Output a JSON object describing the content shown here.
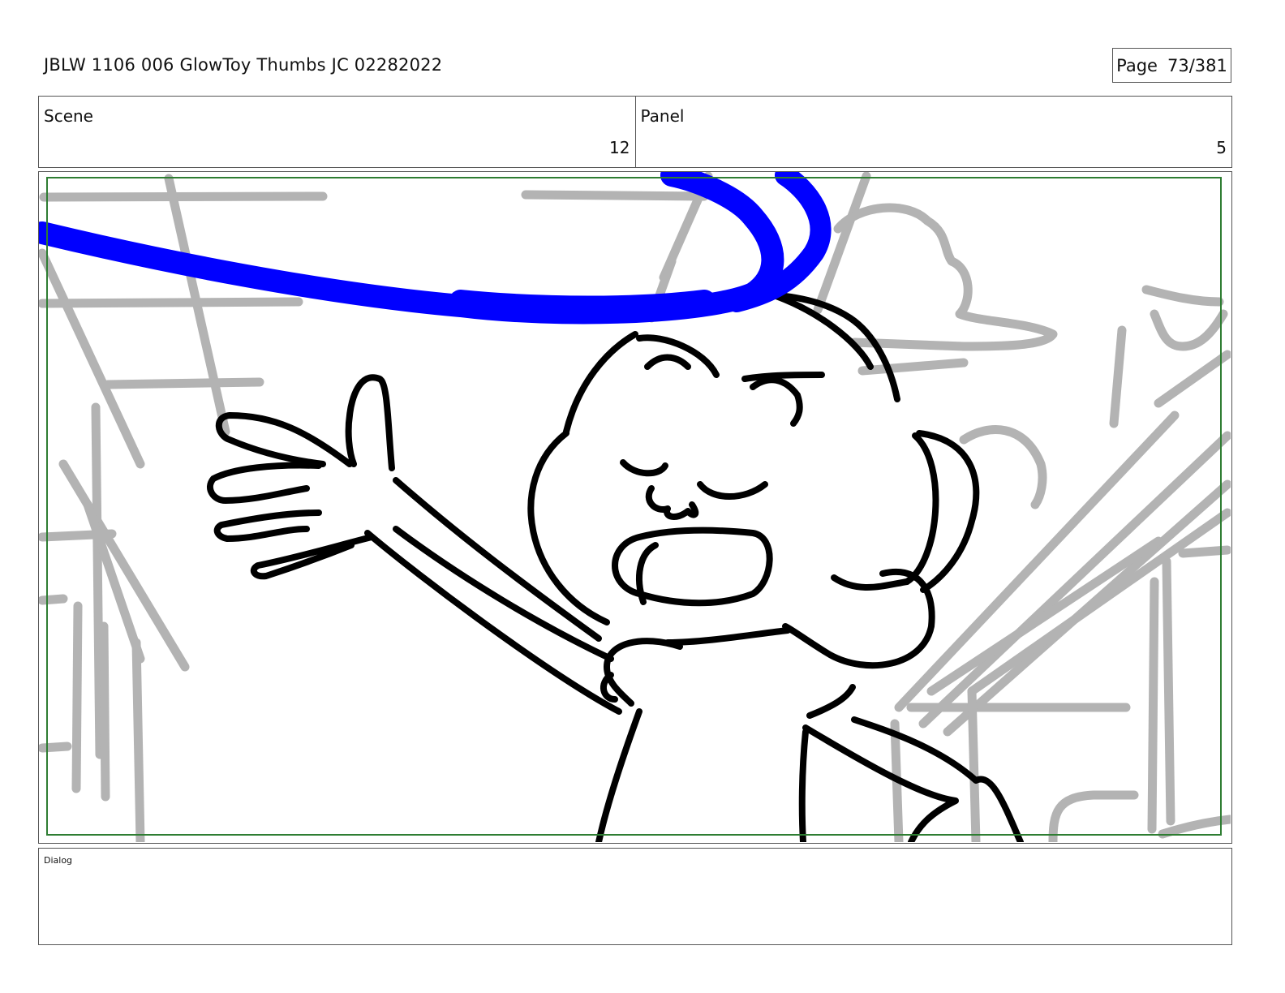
{
  "header": {
    "title": "JBLW 1106 006 GlowToy Thumbs JC 02282022",
    "page_label": "Page",
    "page_value": "73/381"
  },
  "info": {
    "scene_label": "Scene",
    "scene_value": "12",
    "panel_label": "Panel",
    "panel_value": "5"
  },
  "panel": {
    "image_name": "storyboard-sketch",
    "colors": {
      "background_sketch": "#b3b3b3",
      "character_line": "#000000",
      "motion_line": "#0000ff",
      "safe_frame": "#2e7d32"
    }
  },
  "dialog": {
    "label": "Dialog",
    "text": ""
  }
}
